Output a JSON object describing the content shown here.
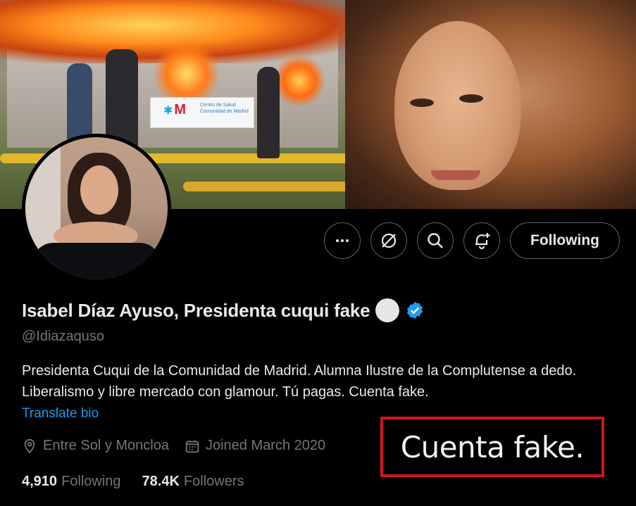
{
  "banner": {
    "sign_logo": "M",
    "sign_text": [
      "Centro de Salud",
      "Comunidad de Madrid"
    ]
  },
  "profile": {
    "name": "Isabel Díaz Ayuso, Presidenta cuqui fake",
    "handle": "@Idiazaquso",
    "bio": "Presidenta Cuqui de la Comunidad de Madrid. Alumna Ilustre de la Complutense a dedo. Liberalismo y libre mercado con glamour. Tú pagas. Cuenta fake.",
    "translate_label": "Translate bio",
    "location": "Entre Sol y Moncloa",
    "joined": "Joined March 2020",
    "following_count": "4,910",
    "following_label": "Following",
    "followers_count": "78.4K",
    "followers_label": "Followers"
  },
  "actions": {
    "more_icon": "more-icon",
    "grok_icon": "grok-icon",
    "search_icon": "search-icon",
    "notify_icon": "bell-plus-icon",
    "follow_label": "Following"
  },
  "annotation": {
    "text": "Cuenta fake.",
    "border_color": "#d4131f"
  },
  "colors": {
    "background": "#000000",
    "link": "#1d9bf0",
    "muted": "#71767b",
    "verified": "#1d9bf0"
  }
}
